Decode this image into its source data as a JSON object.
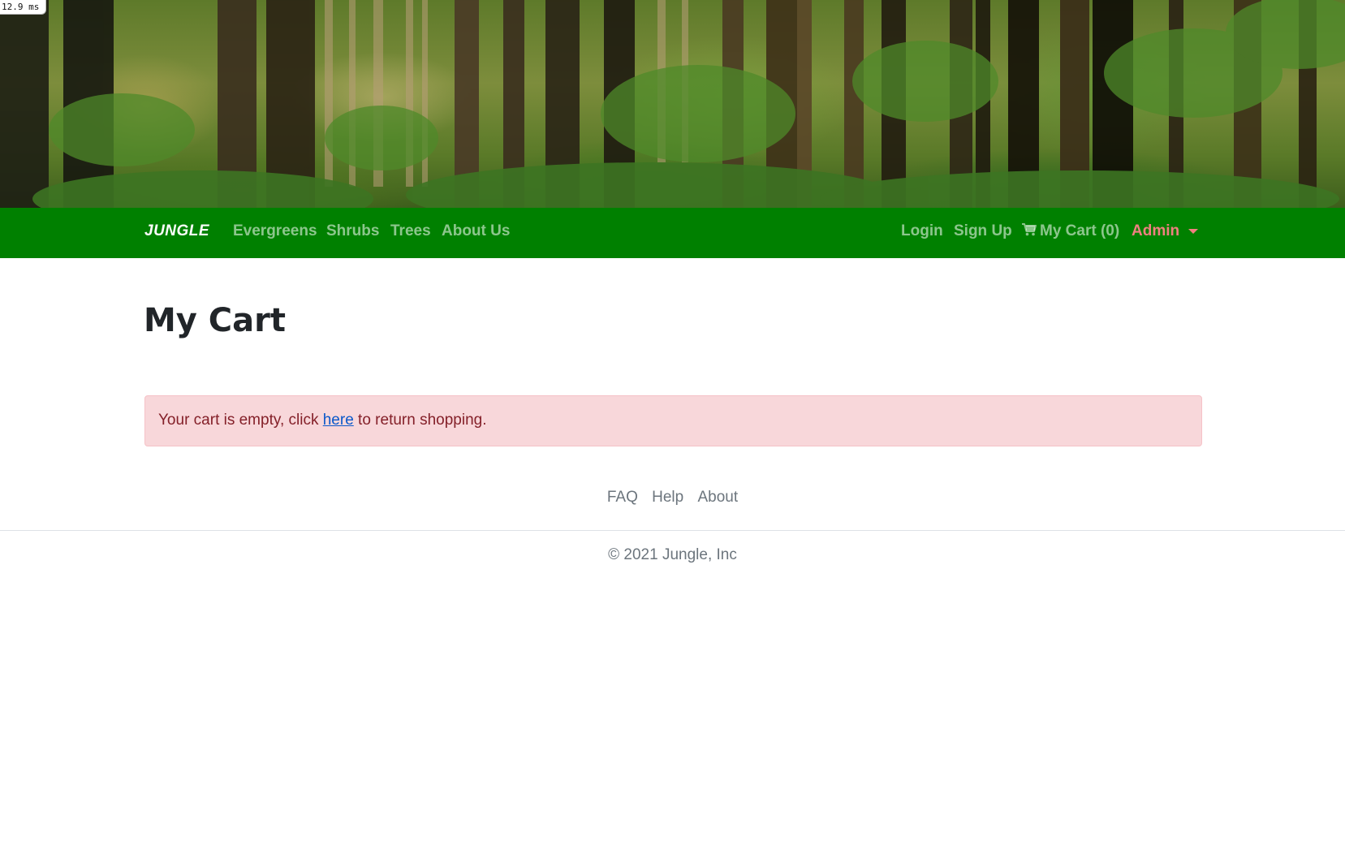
{
  "perf_badge": "12.9 ms",
  "navbar": {
    "brand": "JUNGLE",
    "left_links": [
      "Evergreens",
      "Shrubs",
      "Trees",
      "About Us"
    ],
    "login": "Login",
    "signup": "Sign Up",
    "cart_label": "My Cart (0)",
    "admin": "Admin",
    "bg_color": "#008000",
    "admin_color": "#f08080"
  },
  "main": {
    "title": "My Cart",
    "alert": {
      "text_before": "Your cart is empty, click ",
      "link_text": "here",
      "text_after": " to return shopping.",
      "bg_color": "#f8d7da"
    }
  },
  "footer": {
    "links": [
      "FAQ",
      "Help",
      "About"
    ],
    "copyright": "© 2021 Jungle, Inc"
  },
  "icons": {
    "cart": "shopping-cart-icon",
    "admin_dropdown": "caret-down-icon"
  }
}
